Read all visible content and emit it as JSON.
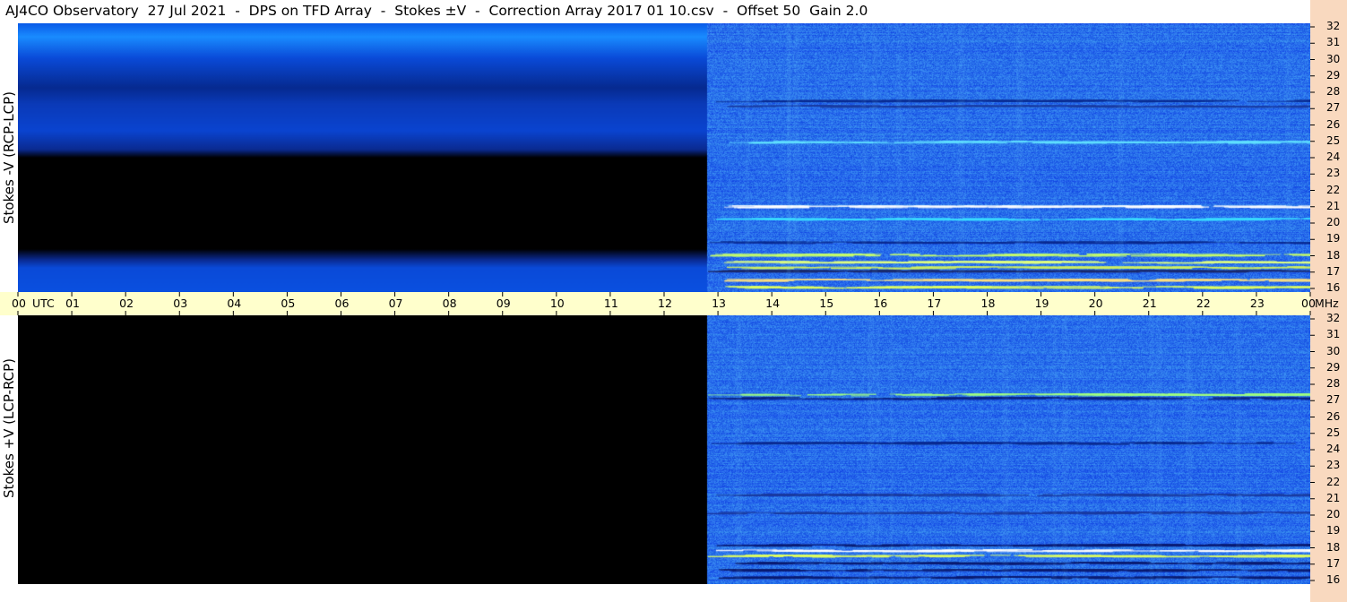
{
  "title": "AJ4CO Observatory  27 Jul 2021  -  DPS on TFD Array  -  Stokes ±V  -  Correction Array 2017 01 10.csv  -  Offset 50  Gain 2.0",
  "chart_data": {
    "type": "heatmap",
    "panels": [
      {
        "name": "top",
        "ylabel": "Stokes -V (RCP-LCP)"
      },
      {
        "name": "bottom",
        "ylabel": "Stokes +V (LCP-RCP)"
      }
    ],
    "x": {
      "unit_label": "UTC",
      "range": [
        0,
        24
      ],
      "tick_labels": [
        "00",
        "01",
        "02",
        "03",
        "04",
        "05",
        "06",
        "07",
        "08",
        "09",
        "10",
        "11",
        "12",
        "13",
        "14",
        "15",
        "16",
        "17",
        "18",
        "19",
        "20",
        "21",
        "22",
        "23",
        "00"
      ]
    },
    "y": {
      "unit_label": "MHz",
      "range": [
        16,
        32
      ],
      "tick_labels": [
        "32",
        "31",
        "30",
        "29",
        "28",
        "27",
        "26",
        "25",
        "24",
        "23",
        "22",
        "21",
        "20",
        "19",
        "18",
        "17",
        "16"
      ]
    },
    "data_start_utc": 12.8,
    "colors": {
      "background": "#000000",
      "noise_base": "#2a6cf0",
      "axis_band": "#ffffcc",
      "right_band": "#f9d9bf"
    }
  }
}
